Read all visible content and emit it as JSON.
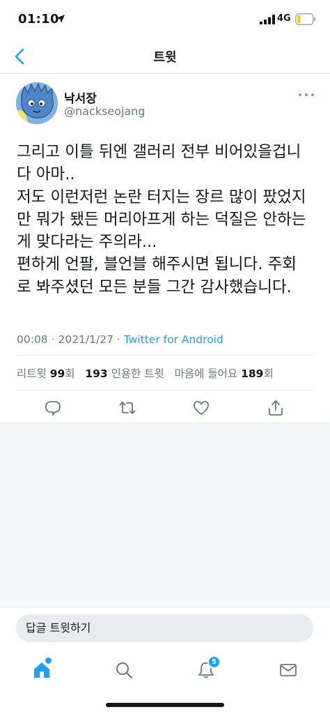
{
  "status_bar": {
    "time": "01:10",
    "network": "4G"
  },
  "nav": {
    "title": "트윗"
  },
  "tweet": {
    "display_name": "낙서장",
    "handle": "@nackseojang",
    "text_lines": [
      "그리고 이틀 뒤엔 갤러리 전부 비어있을겁니",
      "다 아마..",
      "저도 이런저런 논란 터지는 장르 많이 팠었지",
      "만 뭐가 됐든 머리아프게 하는 덕질은 안하는",
      "게 맞다라는 주의라...",
      "편하게 언팔, 블언블 해주시면 됩니다. 주회",
      "로 봐주셨던 모든 분들 그간 감사했습니다."
    ],
    "time": "00:08",
    "date": "2021/1/27",
    "separator": "·",
    "source": "Twitter for Android",
    "stats": {
      "retweets_label": "리트윗",
      "retweets_count": "99",
      "retweets_suffix": "회",
      "quotes_count": "193",
      "quotes_label": "인용한 트윗",
      "likes_label": "마음에 들어요",
      "likes_count": "189",
      "likes_suffix": "회"
    }
  },
  "reply": {
    "placeholder": "답글 트윗하기"
  },
  "tabs": {
    "notifications_badge": "5"
  },
  "colors": {
    "accent": "#1da1f2",
    "text": "#14171a",
    "secondary": "#657786",
    "divider": "#e1e8ed"
  },
  "icons": [
    "location-arrow-icon",
    "signal-icon",
    "battery-icon",
    "back-chevron-icon",
    "more-icon",
    "reply-icon",
    "retweet-icon",
    "like-icon",
    "share-icon",
    "home-icon",
    "search-icon",
    "notifications-icon",
    "messages-icon"
  ]
}
